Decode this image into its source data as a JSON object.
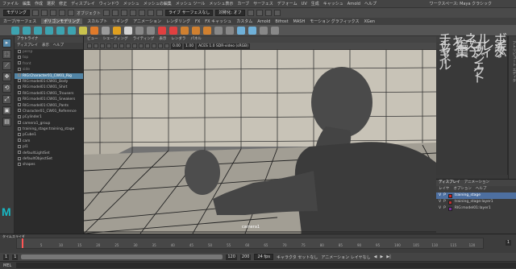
{
  "menubar": {
    "items": [
      "ファイル",
      "編集",
      "作成",
      "選択",
      "修正",
      "ディスプレイ",
      "ウィンドウ",
      "メッシュ",
      "メッシュの編集",
      "メッシュ ツール",
      "メッシュ表示",
      "カーブ",
      "サーフェス",
      "デフォーム",
      "UV",
      "生成",
      "キャッシュ",
      "Arnold",
      "ヘルプ"
    ],
    "workspace": "ワークスペース: Maya クラシック"
  },
  "statusline": {
    "mode": "モデリング",
    "objects_label": "オブジェクト",
    "live_surface": "ライブ サーフェスなし",
    "symmetry": "対称化: オフ",
    "field": "",
    "search": ""
  },
  "shelf": {
    "tabs": [
      "カーブ/サーフェス",
      "ポリゴンモデリング",
      "スカルプト",
      "リギング",
      "アニメーション",
      "レンダリング",
      "FX",
      "FX キャッシュ",
      "カスタム",
      "Arnold",
      "Bifrost",
      "MASH",
      "モーション グラフィックス",
      "XGen"
    ],
    "active": 1
  },
  "tools": [
    "▸",
    "⬚",
    "⟋",
    "✥",
    "⟲",
    "⤢",
    "▣",
    "▤"
  ],
  "outliner": {
    "title": "アウトライナ",
    "menu": [
      "ディスプレイ",
      "表示",
      "ヘルプ"
    ],
    "rows": [
      {
        "label": "persp",
        "state": "dim"
      },
      {
        "label": "top",
        "state": "dim"
      },
      {
        "label": "front",
        "state": "dim"
      },
      {
        "label": "side",
        "state": "dim"
      },
      {
        "label": "RIG:Character01_CW01_Rig",
        "state": "sel"
      },
      {
        "label": "RIG:model01:CW01_Body",
        "state": ""
      },
      {
        "label": "RIG:model01:CW01_Shirt",
        "state": ""
      },
      {
        "label": "RIG:model01:CW01_Trousers",
        "state": ""
      },
      {
        "label": "RIG:model01:CW01_Sneakers",
        "state": ""
      },
      {
        "label": "RIG:model01:CW01_Pants",
        "state": ""
      },
      {
        "label": "Character01_CW01_Reference",
        "state": ""
      },
      {
        "label": "pCylinder1",
        "state": ""
      },
      {
        "label": "camera1_group",
        "state": ""
      },
      {
        "label": "training_stage:training_stage",
        "state": ""
      },
      {
        "label": "pCube1",
        "state": ""
      },
      {
        "label": "cam",
        "state": ""
      },
      {
        "label": "pl1",
        "state": ""
      },
      {
        "label": "defaultLightSet",
        "state": ""
      },
      {
        "label": "defaultObjectSet",
        "state": ""
      },
      {
        "label": "shapes",
        "state": ""
      }
    ]
  },
  "viewport": {
    "menu": [
      "ビュー",
      "シェーディング",
      "ライティング",
      "表示",
      "レンダラ",
      "パネル"
    ],
    "gamma": "0.00",
    "exposure": "1.00",
    "colorspace": "ACES 1.0 SDR-video (sRGB)",
    "camera": "camera1"
  },
  "channel": {
    "title": "チャネル ボックス/レイヤ エディタ",
    "menu": [
      "チャネル",
      "編集",
      "オブジェクト",
      "表示"
    ]
  },
  "layers": {
    "tabs": [
      "ディスプレイ",
      "アニメーション"
    ],
    "menu": [
      "レイヤ",
      "オプション",
      "ヘルプ"
    ],
    "rows": [
      {
        "v": "V",
        "p": "P",
        "color": "#d02020",
        "name": "training_stage",
        "sel": true
      },
      {
        "v": "V",
        "p": "P",
        "color": "#c23030",
        "name": "training_stage:layer1",
        "sel": false
      },
      {
        "v": "V",
        "p": "P",
        "color": "#7a2f9e",
        "name": "RIG:model01:layer1",
        "sel": false
      }
    ]
  },
  "timeslider": {
    "title": "タイムスライダ",
    "frames": [
      "1",
      "5",
      "10",
      "15",
      "20",
      "25",
      "30",
      "35",
      "40",
      "45",
      "50",
      "55",
      "60",
      "65",
      "70",
      "75",
      "80",
      "85",
      "90",
      "95",
      "100",
      "105",
      "110",
      "115",
      "120"
    ],
    "current": "1"
  },
  "range": {
    "start": "1",
    "end": "120",
    "anim_end": "200",
    "fps": "24 fps",
    "char_set": "キャラクタ セットなし",
    "anim_layer": "アニメーション レイヤなし"
  },
  "cmdline": {
    "lang": "MEL",
    "text": ""
  },
  "colors": {
    "accent": "#5285a6",
    "logo": "#18b8c4",
    "layer_red": "#d02020"
  }
}
